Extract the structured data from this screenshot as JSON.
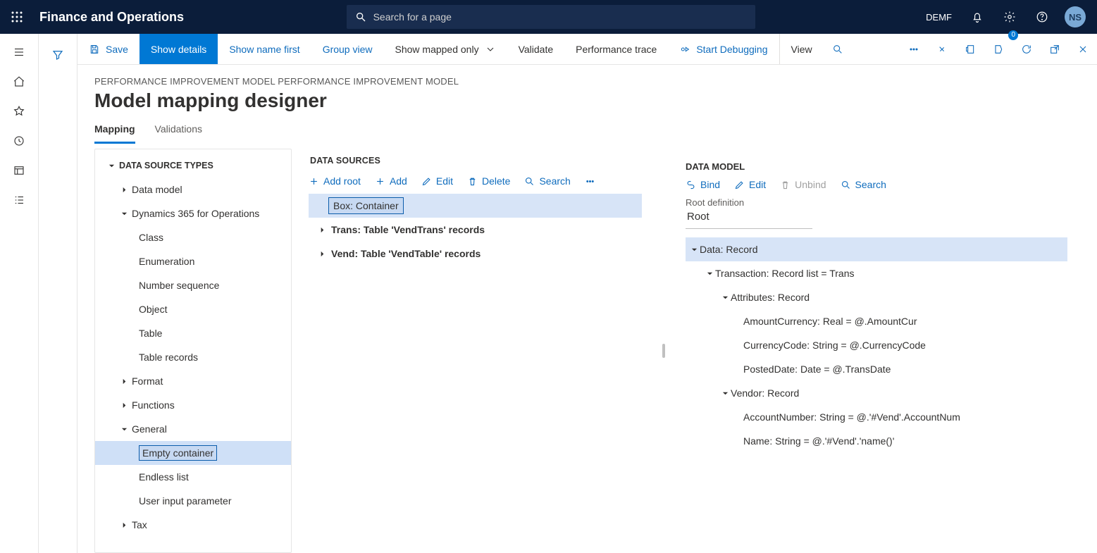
{
  "topbar": {
    "brand": "Finance and Operations",
    "search_placeholder": "Search for a page",
    "company": "DEMF",
    "avatar": "NS"
  },
  "cmdbar": {
    "save": "Save",
    "show_details": "Show details",
    "show_name_first": "Show name first",
    "group_view": "Group view",
    "show_mapped_only": "Show mapped only",
    "validate": "Validate",
    "perf_trace": "Performance trace",
    "start_debugging": "Start Debugging",
    "view": "View",
    "msg_count": "0"
  },
  "page": {
    "crumb": "PERFORMANCE IMPROVEMENT MODEL PERFORMANCE IMPROVEMENT MODEL",
    "title": "Model mapping designer",
    "tab_mapping": "Mapping",
    "tab_validations": "Validations"
  },
  "types": {
    "title": "DATA SOURCE TYPES",
    "items": {
      "data_model": "Data model",
      "d365": "Dynamics 365 for Operations",
      "class": "Class",
      "enum": "Enumeration",
      "numseq": "Number sequence",
      "object": "Object",
      "table": "Table",
      "table_records": "Table records",
      "format": "Format",
      "functions": "Functions",
      "general": "General",
      "empty_container": "Empty container",
      "endless_list": "Endless list",
      "user_input": "User input parameter",
      "tax": "Tax"
    }
  },
  "sources": {
    "title": "DATA SOURCES",
    "btn_add_root": "Add root",
    "btn_add": "Add",
    "btn_edit": "Edit",
    "btn_delete": "Delete",
    "btn_search": "Search",
    "rows": {
      "box": "Box: Container",
      "trans": "Trans: Table 'VendTrans' records",
      "vend": "Vend: Table 'VendTable' records"
    }
  },
  "model": {
    "title": "DATA MODEL",
    "btn_bind": "Bind",
    "btn_edit": "Edit",
    "btn_unbind": "Unbind",
    "btn_search": "Search",
    "root_label": "Root definition",
    "root_value": "Root",
    "rows": {
      "data": "Data: Record",
      "transaction": "Transaction: Record list = Trans",
      "attributes": "Attributes: Record",
      "amount": "AmountCurrency: Real = @.AmountCur",
      "currency": "CurrencyCode: String = @.CurrencyCode",
      "posted": "PostedDate: Date = @.TransDate",
      "vendor": "Vendor: Record",
      "account": "AccountNumber: String = @.'#Vend'.AccountNum",
      "name": "Name: String = @.'#Vend'.'name()'"
    }
  }
}
